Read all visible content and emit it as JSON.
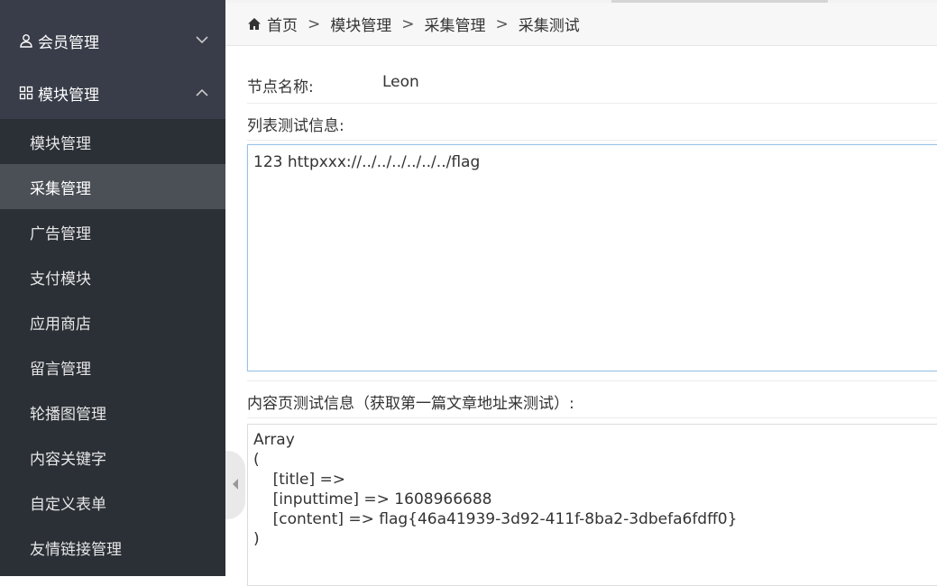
{
  "sidebar": {
    "groups": [
      {
        "label": "会员管理",
        "icon": "user-icon",
        "chevron": "chevron-down-icon"
      },
      {
        "label": "模块管理",
        "icon": "grid-icon",
        "chevron": "chevron-up-icon"
      }
    ],
    "items": [
      {
        "label": "模块管理"
      },
      {
        "label": "采集管理",
        "active": true
      },
      {
        "label": "广告管理"
      },
      {
        "label": "支付模块"
      },
      {
        "label": "应用商店"
      },
      {
        "label": "留言管理"
      },
      {
        "label": "轮播图管理"
      },
      {
        "label": "内容关键字"
      },
      {
        "label": "自定义表单"
      },
      {
        "label": "友情链接管理"
      }
    ]
  },
  "breadcrumb": {
    "home": "首页",
    "sep": ">",
    "crumbs": [
      "模块管理",
      "采集管理",
      "采集测试"
    ]
  },
  "form": {
    "node_name_label": "节点名称:",
    "node_name_value": "Leon",
    "list_test_label": "列表测试信息:",
    "list_test_content": "123 httpxxx://../../../../../../flag",
    "content_test_label": "内容页测试信息（获取第一篇文章地址来测试）:",
    "content_test_output": "Array\n(\n    [title] => \n    [inputtime] => 1608966688\n    [content] => flag{46a41939-3d92-411f-8ba2-3dbefa6fdff0}\n)"
  },
  "colors": {
    "sidebar_bg": "#393d49",
    "subnav_bg": "#2b2f36",
    "active_item_bg": "#4b4f56"
  }
}
